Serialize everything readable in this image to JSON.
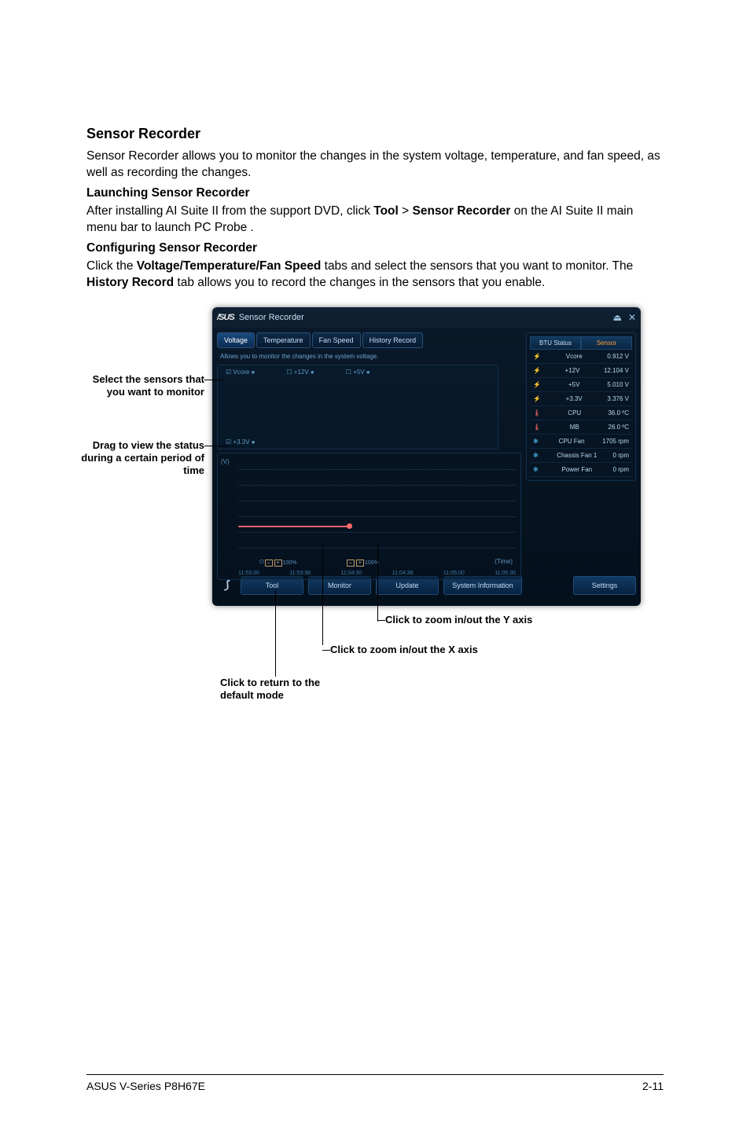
{
  "doc": {
    "title": "Sensor Recorder",
    "intro": "Sensor Recorder allows you to monitor the changes in the system voltage, temperature, and fan speed, as well as recording the changes.",
    "launch_title": "Launching Sensor Recorder",
    "launch_text_a": "After installing AI Suite II from the support DVD, click ",
    "launch_tool": "Tool",
    "launch_gt": " > ",
    "launch_sr": "Sensor Recorder",
    "launch_text_b": " on the AI Suite II main menu bar to launch PC Probe .",
    "config_title": "Configuring Sensor Recorder",
    "config_text_a": "Click the ",
    "config_tabs": "Voltage/Temperature/Fan Speed",
    "config_text_b": " tabs and select the sensors that you want to monitor. The ",
    "config_hist": "History Record",
    "config_text_c": " tab allows you to record the changes in the sensors that you enable."
  },
  "anno": {
    "select": "Select the sensors that you want to monitor",
    "drag": "Drag to view the status during a certain period of time",
    "return": "Click to return to the default mode",
    "zoomx": "Click to zoom in/out the X axis",
    "zoomy": "Click to zoom in/out the Y axis"
  },
  "sr": {
    "logo": "/SUS",
    "app": "Sensor Recorder",
    "tabs": {
      "voltage": "Voltage",
      "temperature": "Temperature",
      "fanspeed": "Fan Speed",
      "history": "History Record"
    },
    "helptext": "Allows you to monitor the changes in the system voltage.",
    "checks": {
      "vcore": "Vcore ●",
      "v12": "+12V ●",
      "v5": "+5V ●",
      "v33": "+3.3V ●"
    },
    "ylabel": "(V)",
    "xaxis": [
      "11:53:30",
      "11:53:38",
      "11:04:30",
      "11:04:38",
      "11:05:00",
      "11:05:30"
    ],
    "timelabel": "(Time)",
    "zoomX": "100%",
    "zoomY": "100%",
    "right_hdr": {
      "status": "BTU Status",
      "sensor": "Sensor"
    },
    "ritems": [
      {
        "cls": "volt",
        "name": "Vcore",
        "val": "0.912 V"
      },
      {
        "cls": "volt",
        "name": "+12V",
        "val": "12.104 V"
      },
      {
        "cls": "volt",
        "name": "+5V",
        "val": "5.010 V"
      },
      {
        "cls": "volt",
        "name": "+3.3V",
        "val": "3.376 V"
      },
      {
        "cls": "temp",
        "name": "CPU",
        "val": "36.0 ºC"
      },
      {
        "cls": "temp",
        "name": "MB",
        "val": "26.0 ºC"
      },
      {
        "cls": "fan",
        "name": "CPU Fan",
        "val": "1705 rpm"
      },
      {
        "cls": "fan",
        "name": "Chassis Fan 1",
        "val": "0 rpm"
      },
      {
        "cls": "fan",
        "name": "Power Fan",
        "val": "0 rpm"
      }
    ],
    "bottom": {
      "tool": "Tool",
      "monitor": "Monitor",
      "update": "Update",
      "sysinfo": "System Information",
      "settings": "Settings"
    },
    "winbtns": {
      "pin": "⏏",
      "close": "✕"
    }
  },
  "footer": {
    "left": "ASUS V-Series P8H67E",
    "right": "2-11"
  }
}
